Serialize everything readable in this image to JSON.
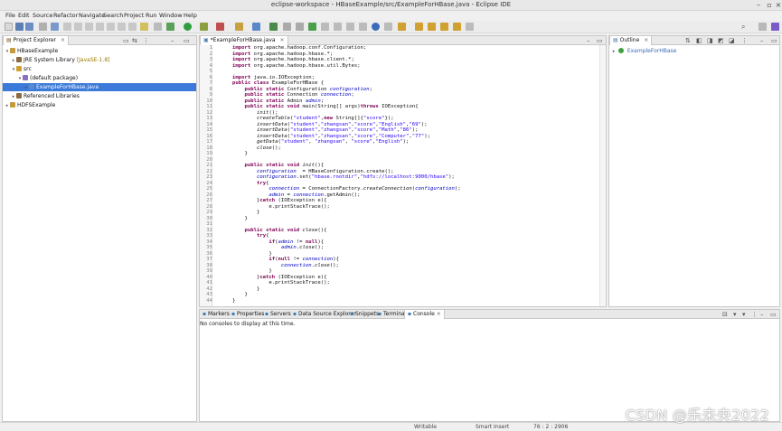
{
  "window": {
    "title": "eclipse-workspace - HBaseExample/src/ExampleForHBase.java - Eclipse IDE"
  },
  "menus": [
    "File",
    "Edit",
    "Source",
    "Refactor",
    "Navigate",
    "Search",
    "Project",
    "Run",
    "Window",
    "Help"
  ],
  "project_explorer": {
    "tab_label": "Project Explorer",
    "items": [
      {
        "label": "HBaseExample",
        "icon": "project-icon",
        "depth": 0,
        "twisty": "expanded"
      },
      {
        "label": "JRE System Library",
        "decoration": "[JavaSE-1.8]",
        "icon": "library-icon",
        "depth": 1,
        "twisty": "collapsed"
      },
      {
        "label": "src",
        "icon": "source-folder-icon",
        "depth": 1,
        "twisty": "expanded"
      },
      {
        "label": "(default package)",
        "icon": "package-icon",
        "depth": 2,
        "twisty": "expanded"
      },
      {
        "label": "ExampleForHBase.java",
        "icon": "java-file-icon",
        "depth": 3,
        "twisty": "collapsed",
        "selected": true
      },
      {
        "label": "Referenced Libraries",
        "icon": "library-icon",
        "depth": 1,
        "twisty": "collapsed"
      },
      {
        "label": "HDFSExample",
        "icon": "project-icon",
        "depth": 0,
        "twisty": "collapsed"
      }
    ]
  },
  "editor": {
    "tab_label": "*ExampleForHBase.java",
    "lines": [
      "import org.apache.hadoop.conf.Configuration;",
      "import org.apache.hadoop.hbase.*;",
      "import org.apache.hadoop.hbase.client.*;",
      "import org.apache.hadoop.hbase.util.Bytes;",
      "",
      "import java.io.IOException;",
      "public class ExampleForHBase {",
      "    public static Configuration configuration;",
      "    public static Connection connection;",
      "    public static Admin admin;",
      "    public static void main(String[] args)throws IOException{",
      "        init();",
      "        createTable(\"student\",new String[]{\"score\"});",
      "        insertData(\"student\",\"zhangsan\",\"score\",\"English\",\"69\");",
      "        insertData(\"student\",\"zhangsan\",\"score\",\"Math\",\"86\");",
      "        insertData(\"student\",\"zhangsan\",\"score\",\"Computer\",\"77\");",
      "        getData(\"student\", \"zhangsan\", \"score\",\"English\");",
      "        close();",
      "    }",
      "",
      "    public static void init(){",
      "        configuration  = HBaseConfiguration.create();",
      "        configuration.set(\"hbase.rootdir\",\"hdfs://localhost:9000/hbase\");",
      "        try{",
      "            connection = ConnectionFactory.createConnection(configuration);",
      "            admin = connection.getAdmin();",
      "        }catch (IOException e){",
      "            e.printStackTrace();",
      "        }",
      "    }",
      "",
      "    public static void close(){",
      "        try{",
      "            if(admin != null){",
      "                admin.close();",
      "            }",
      "            if(null != connection){",
      "                connection.close();",
      "            }",
      "        }catch (IOException e){",
      "            e.printStackTrace();",
      "        }",
      "    }",
      "}"
    ]
  },
  "outline": {
    "tab_label": "Outline",
    "items": [
      {
        "label": "ExampleForHBase",
        "icon": "class-icon"
      }
    ]
  },
  "bottom": {
    "tabs": [
      "Markers",
      "Properties",
      "Servers",
      "Data Source Explorer",
      "Snippets",
      "Terminal",
      "Console"
    ],
    "active_tab": "Console",
    "message": "No consoles to display at this time."
  },
  "status": {
    "writable": "Writable",
    "insert_mode": "Smart Insert",
    "position": "76 : 2 : 2906"
  },
  "watermark": "CSDN @乐未央2022",
  "colors": {
    "keyword": "#7f0055",
    "field": "#0000c0",
    "string": "#2a00ff",
    "selection": "#3b7ad8"
  }
}
